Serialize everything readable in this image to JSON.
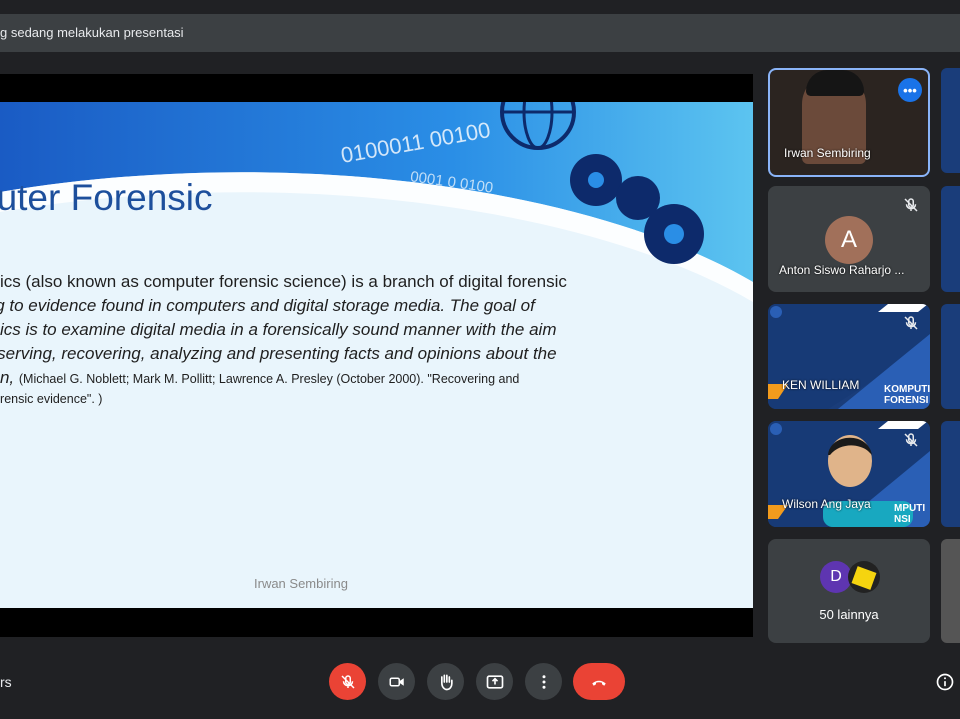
{
  "banner": {
    "text": "g sedang melakukan presentasi"
  },
  "slide": {
    "title": "puter Forensic",
    "lines": [
      "nsics (also known as computer forensic science) is a branch of digital forensic",
      "ing to evidence found in computers and digital storage media. The goal of",
      "nsics is to examine digital media in a forensically sound manner with the aim",
      "reserving, recovering, analyzing and presenting facts and opinions about the",
      "tion,"
    ],
    "citation_1": "(Michael G. Noblett; Mark M. Pollitt; Lawrence A. Presley (October 2000). \"Recovering and",
    "citation_2": "r forensic evidence\". )",
    "footer": "Irwan Sembiring",
    "binary_1": "0100011 00100",
    "binary_2": "0001 0 0100"
  },
  "participants": [
    {
      "name": "Irwan Sembiring"
    },
    {
      "name": "Anton Siswo Raharjo ...",
      "avatar_letter": "A"
    },
    {
      "name": "KEN WILLIAM",
      "brand": "KOMPUTI FORENSI"
    },
    {
      "name": "Wilson Ang Jaya",
      "brand": "MPUTI NSI"
    }
  ],
  "more": {
    "avatar_letter": "D",
    "label": "50 lainnya"
  },
  "bottom_left": "rs",
  "colors": {
    "accent_blue": "#1a73e8",
    "danger": "#ea4335",
    "slide_title": "#1d4f9c"
  },
  "icons": [
    "more-icon",
    "mic-off-icon",
    "camera-icon",
    "raise-hand-icon",
    "present-icon",
    "more-vert-icon",
    "hangup-icon",
    "info-icon"
  ]
}
